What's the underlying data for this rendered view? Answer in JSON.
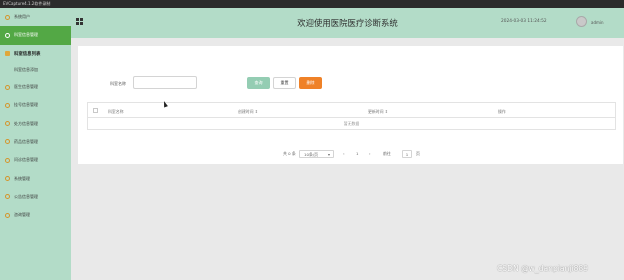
{
  "window": {
    "title": "EVCapture4.1.2软件录制"
  },
  "header": {
    "title": "欢迎使用医院医疗诊断系统",
    "datetime": "2024-03-03 11:24:52",
    "user": "admin"
  },
  "sidebar": {
    "items": [
      {
        "label": "系统用户",
        "state": "normal"
      },
      {
        "label": "科室信息管理",
        "state": "active"
      },
      {
        "label": "科室信息列表",
        "state": "group"
      },
      {
        "label": "科室信息添加",
        "state": "sub"
      },
      {
        "label": "医生信息管理",
        "state": "normal"
      },
      {
        "label": "挂号信息管理",
        "state": "normal"
      },
      {
        "label": "处方信息管理",
        "state": "normal"
      },
      {
        "label": "药品信息管理",
        "state": "normal"
      },
      {
        "label": "问诊信息管理",
        "state": "normal"
      },
      {
        "label": "系统管理",
        "state": "normal"
      },
      {
        "label": "公告信息管理",
        "state": "normal"
      },
      {
        "label": "咨询管理",
        "state": "normal"
      }
    ]
  },
  "search": {
    "label": "科室名称",
    "value": "",
    "placeholder": ""
  },
  "buttons": {
    "query": "查询",
    "reset": "重置",
    "delete": "删除"
  },
  "table": {
    "columns": [
      "科室名称",
      "创建时间 ⇕",
      "更新时间 ⇕",
      "操作"
    ],
    "empty_text": "暂无数据"
  },
  "pagination": {
    "total_label": "共 0 条",
    "page_size": "10条/页",
    "page_size_arrow": "▾",
    "prev": "‹",
    "current_page": "1",
    "next": "›",
    "goto_label": "前往",
    "goto_value": "1",
    "page_unit": "页"
  },
  "watermark": "CSDN @w_danpianji889",
  "colors": {
    "sidebar_bg": "#b3dcc8",
    "active_item": "#53a845",
    "query_button": "#94cdb3",
    "delete_button": "#ef8127"
  }
}
